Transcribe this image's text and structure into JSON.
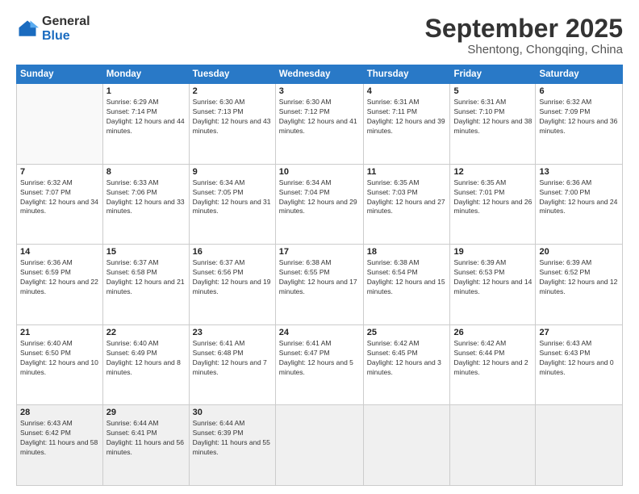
{
  "logo": {
    "general": "General",
    "blue": "Blue"
  },
  "header": {
    "month": "September 2025",
    "location": "Shentong, Chongqing, China"
  },
  "days_of_week": [
    "Sunday",
    "Monday",
    "Tuesday",
    "Wednesday",
    "Thursday",
    "Friday",
    "Saturday"
  ],
  "weeks": [
    [
      {
        "day": "",
        "sunrise": "",
        "sunset": "",
        "daylight": ""
      },
      {
        "day": "1",
        "sunrise": "Sunrise: 6:29 AM",
        "sunset": "Sunset: 7:14 PM",
        "daylight": "Daylight: 12 hours and 44 minutes."
      },
      {
        "day": "2",
        "sunrise": "Sunrise: 6:30 AM",
        "sunset": "Sunset: 7:13 PM",
        "daylight": "Daylight: 12 hours and 43 minutes."
      },
      {
        "day": "3",
        "sunrise": "Sunrise: 6:30 AM",
        "sunset": "Sunset: 7:12 PM",
        "daylight": "Daylight: 12 hours and 41 minutes."
      },
      {
        "day": "4",
        "sunrise": "Sunrise: 6:31 AM",
        "sunset": "Sunset: 7:11 PM",
        "daylight": "Daylight: 12 hours and 39 minutes."
      },
      {
        "day": "5",
        "sunrise": "Sunrise: 6:31 AM",
        "sunset": "Sunset: 7:10 PM",
        "daylight": "Daylight: 12 hours and 38 minutes."
      },
      {
        "day": "6",
        "sunrise": "Sunrise: 6:32 AM",
        "sunset": "Sunset: 7:09 PM",
        "daylight": "Daylight: 12 hours and 36 minutes."
      }
    ],
    [
      {
        "day": "7",
        "sunrise": "Sunrise: 6:32 AM",
        "sunset": "Sunset: 7:07 PM",
        "daylight": "Daylight: 12 hours and 34 minutes."
      },
      {
        "day": "8",
        "sunrise": "Sunrise: 6:33 AM",
        "sunset": "Sunset: 7:06 PM",
        "daylight": "Daylight: 12 hours and 33 minutes."
      },
      {
        "day": "9",
        "sunrise": "Sunrise: 6:34 AM",
        "sunset": "Sunset: 7:05 PM",
        "daylight": "Daylight: 12 hours and 31 minutes."
      },
      {
        "day": "10",
        "sunrise": "Sunrise: 6:34 AM",
        "sunset": "Sunset: 7:04 PM",
        "daylight": "Daylight: 12 hours and 29 minutes."
      },
      {
        "day": "11",
        "sunrise": "Sunrise: 6:35 AM",
        "sunset": "Sunset: 7:03 PM",
        "daylight": "Daylight: 12 hours and 27 minutes."
      },
      {
        "day": "12",
        "sunrise": "Sunrise: 6:35 AM",
        "sunset": "Sunset: 7:01 PM",
        "daylight": "Daylight: 12 hours and 26 minutes."
      },
      {
        "day": "13",
        "sunrise": "Sunrise: 6:36 AM",
        "sunset": "Sunset: 7:00 PM",
        "daylight": "Daylight: 12 hours and 24 minutes."
      }
    ],
    [
      {
        "day": "14",
        "sunrise": "Sunrise: 6:36 AM",
        "sunset": "Sunset: 6:59 PM",
        "daylight": "Daylight: 12 hours and 22 minutes."
      },
      {
        "day": "15",
        "sunrise": "Sunrise: 6:37 AM",
        "sunset": "Sunset: 6:58 PM",
        "daylight": "Daylight: 12 hours and 21 minutes."
      },
      {
        "day": "16",
        "sunrise": "Sunrise: 6:37 AM",
        "sunset": "Sunset: 6:56 PM",
        "daylight": "Daylight: 12 hours and 19 minutes."
      },
      {
        "day": "17",
        "sunrise": "Sunrise: 6:38 AM",
        "sunset": "Sunset: 6:55 PM",
        "daylight": "Daylight: 12 hours and 17 minutes."
      },
      {
        "day": "18",
        "sunrise": "Sunrise: 6:38 AM",
        "sunset": "Sunset: 6:54 PM",
        "daylight": "Daylight: 12 hours and 15 minutes."
      },
      {
        "day": "19",
        "sunrise": "Sunrise: 6:39 AM",
        "sunset": "Sunset: 6:53 PM",
        "daylight": "Daylight: 12 hours and 14 minutes."
      },
      {
        "day": "20",
        "sunrise": "Sunrise: 6:39 AM",
        "sunset": "Sunset: 6:52 PM",
        "daylight": "Daylight: 12 hours and 12 minutes."
      }
    ],
    [
      {
        "day": "21",
        "sunrise": "Sunrise: 6:40 AM",
        "sunset": "Sunset: 6:50 PM",
        "daylight": "Daylight: 12 hours and 10 minutes."
      },
      {
        "day": "22",
        "sunrise": "Sunrise: 6:40 AM",
        "sunset": "Sunset: 6:49 PM",
        "daylight": "Daylight: 12 hours and 8 minutes."
      },
      {
        "day": "23",
        "sunrise": "Sunrise: 6:41 AM",
        "sunset": "Sunset: 6:48 PM",
        "daylight": "Daylight: 12 hours and 7 minutes."
      },
      {
        "day": "24",
        "sunrise": "Sunrise: 6:41 AM",
        "sunset": "Sunset: 6:47 PM",
        "daylight": "Daylight: 12 hours and 5 minutes."
      },
      {
        "day": "25",
        "sunrise": "Sunrise: 6:42 AM",
        "sunset": "Sunset: 6:45 PM",
        "daylight": "Daylight: 12 hours and 3 minutes."
      },
      {
        "day": "26",
        "sunrise": "Sunrise: 6:42 AM",
        "sunset": "Sunset: 6:44 PM",
        "daylight": "Daylight: 12 hours and 2 minutes."
      },
      {
        "day": "27",
        "sunrise": "Sunrise: 6:43 AM",
        "sunset": "Sunset: 6:43 PM",
        "daylight": "Daylight: 12 hours and 0 minutes."
      }
    ],
    [
      {
        "day": "28",
        "sunrise": "Sunrise: 6:43 AM",
        "sunset": "Sunset: 6:42 PM",
        "daylight": "Daylight: 11 hours and 58 minutes."
      },
      {
        "day": "29",
        "sunrise": "Sunrise: 6:44 AM",
        "sunset": "Sunset: 6:41 PM",
        "daylight": "Daylight: 11 hours and 56 minutes."
      },
      {
        "day": "30",
        "sunrise": "Sunrise: 6:44 AM",
        "sunset": "Sunset: 6:39 PM",
        "daylight": "Daylight: 11 hours and 55 minutes."
      },
      {
        "day": "",
        "sunrise": "",
        "sunset": "",
        "daylight": ""
      },
      {
        "day": "",
        "sunrise": "",
        "sunset": "",
        "daylight": ""
      },
      {
        "day": "",
        "sunrise": "",
        "sunset": "",
        "daylight": ""
      },
      {
        "day": "",
        "sunrise": "",
        "sunset": "",
        "daylight": ""
      }
    ]
  ]
}
